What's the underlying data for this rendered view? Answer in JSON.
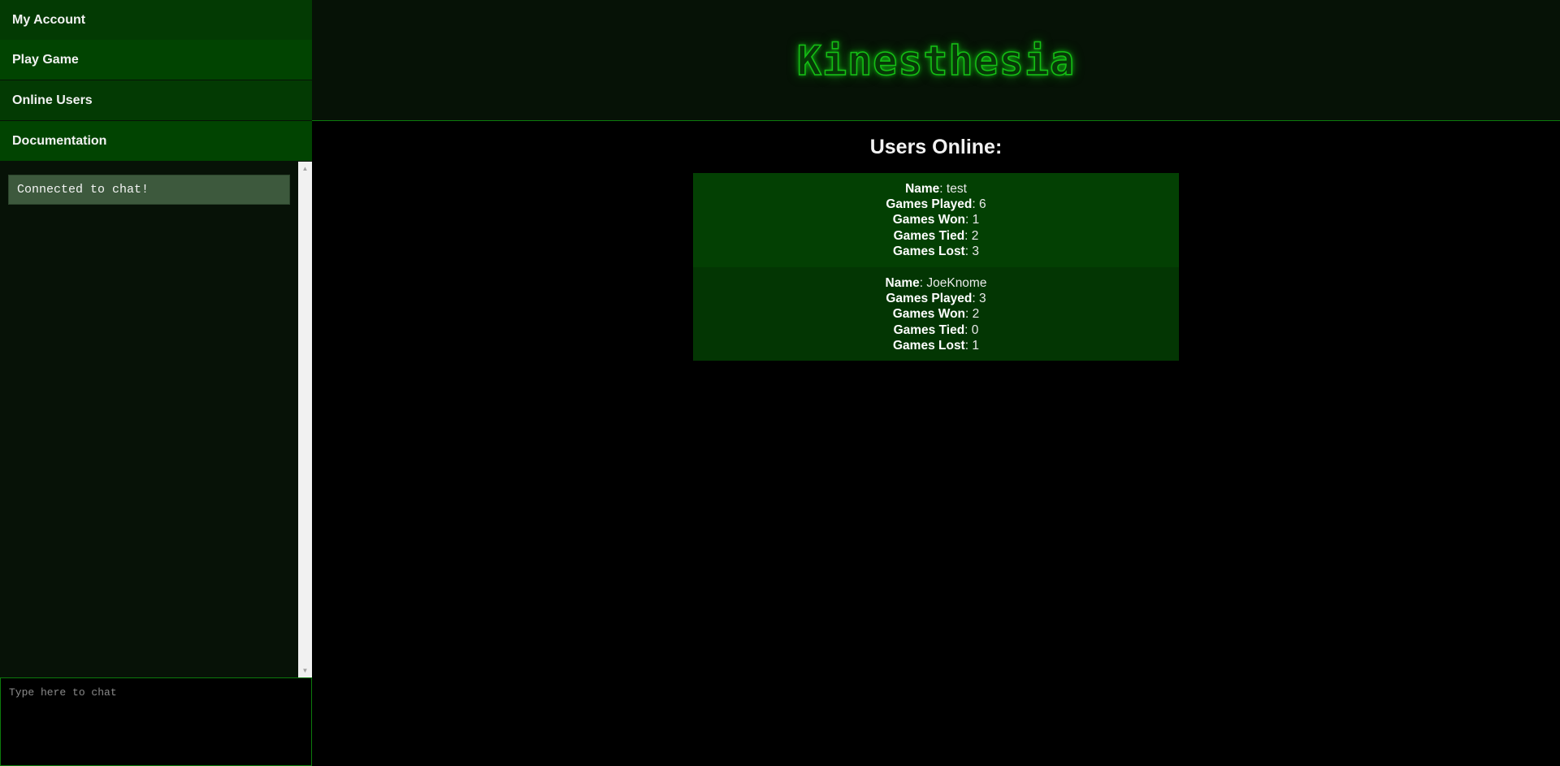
{
  "nav": {
    "items": [
      {
        "label": "My Account"
      },
      {
        "label": "Play Game"
      },
      {
        "label": "Online Users"
      },
      {
        "label": "Documentation"
      }
    ]
  },
  "chat": {
    "messages": [
      "Connected to chat!"
    ],
    "input_placeholder": "Type here to chat",
    "scroll_up_glyph": "▲",
    "scroll_down_glyph": "▼"
  },
  "header": {
    "logo_text": "Kinesthesia"
  },
  "main": {
    "title": "Users Online:",
    "field_labels": {
      "name": "Name",
      "played": "Games Played",
      "won": "Games Won",
      "tied": "Games Tied",
      "lost": "Games Lost"
    },
    "users": [
      {
        "name": "test",
        "played": "6",
        "won": "1",
        "tied": "2",
        "lost": "3"
      },
      {
        "name": "JoeKnome",
        "played": "3",
        "won": "2",
        "tied": "0",
        "lost": "1"
      }
    ]
  },
  "colors": {
    "accent_green": "#15c015",
    "nav_dark": "#033a03",
    "nav_light": "#014401",
    "card_light": "#034003",
    "card_dark": "#033603"
  }
}
